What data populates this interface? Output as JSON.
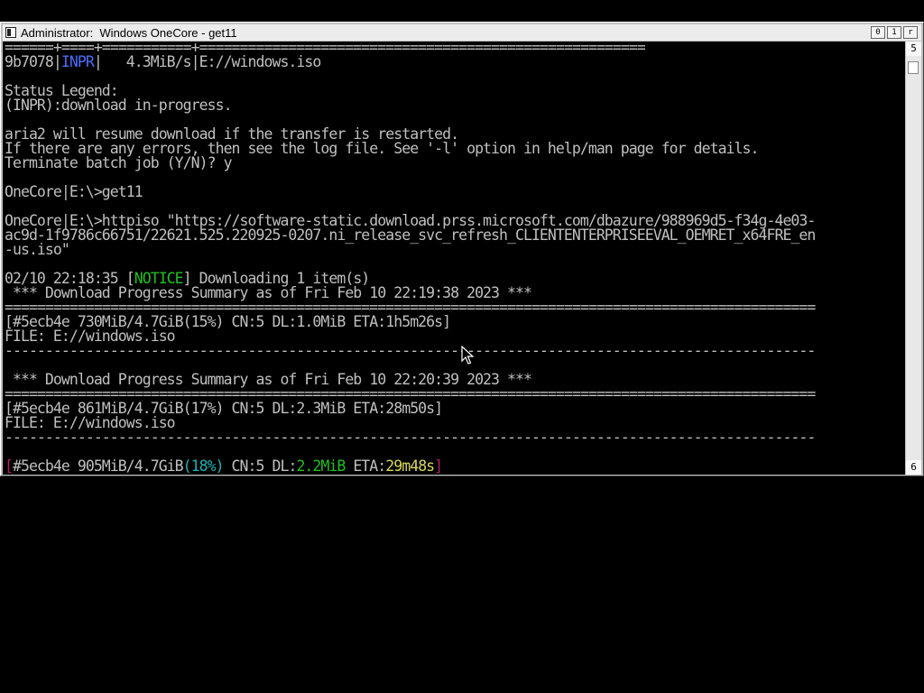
{
  "window": {
    "title": "Administrator:  Windows OneCore - get11",
    "buttons": [
      "0",
      "1",
      "r"
    ]
  },
  "scrollbar": {
    "top_label": "5",
    "bottom_label": "6"
  },
  "console": {
    "lines": [
      {
        "segments": [
          {
            "text": "======+====+===========+=======================================================",
            "color": "default"
          }
        ]
      },
      {
        "segments": [
          {
            "text": "9b7078|",
            "color": "default"
          },
          {
            "text": "INPR",
            "color": "blue"
          },
          {
            "text": "|   4.3MiB/s|E://windows.iso",
            "color": "default"
          }
        ]
      },
      {
        "segments": []
      },
      {
        "segments": [
          {
            "text": "Status Legend:",
            "color": "default"
          }
        ]
      },
      {
        "segments": [
          {
            "text": "(INPR):download in-progress.",
            "color": "default"
          }
        ]
      },
      {
        "segments": []
      },
      {
        "segments": [
          {
            "text": "aria2 will resume download if the transfer is restarted.",
            "color": "default"
          }
        ]
      },
      {
        "segments": [
          {
            "text": "If there are any errors, then see the log file. See '-l' option in help/man page for details.",
            "color": "default"
          }
        ]
      },
      {
        "segments": [
          {
            "text": "Terminate batch job (Y/N)? y",
            "color": "default"
          }
        ]
      },
      {
        "segments": []
      },
      {
        "segments": [
          {
            "text": "OneCore|E:\\>get11",
            "color": "default"
          }
        ]
      },
      {
        "segments": []
      },
      {
        "segments": [
          {
            "text": "OneCore|E:\\>httpiso \"https://software-static.download.prss.microsoft.com/dbazure/988969d5-f34g-4e03-",
            "color": "default"
          }
        ]
      },
      {
        "segments": [
          {
            "text": "ac9d-1f9786c66751/22621.525.220925-0207.ni_release_svc_refresh_CLIENTENTERPRISEEVAL_OEMRET_x64FRE_en",
            "color": "default"
          }
        ]
      },
      {
        "segments": [
          {
            "text": "-us.iso\"",
            "color": "default"
          }
        ]
      },
      {
        "segments": []
      },
      {
        "segments": [
          {
            "text": "02/10 22:18:35 [",
            "color": "default"
          },
          {
            "text": "NOTICE",
            "color": "green"
          },
          {
            "text": "] Downloading 1 item(s)",
            "color": "default"
          }
        ]
      },
      {
        "segments": [
          {
            "text": " *** Download Progress Summary as of Fri Feb 10 22:19:38 2023 ***",
            "color": "default"
          }
        ]
      },
      {
        "segments": [
          {
            "text": "====================================================================================================",
            "color": "default"
          }
        ]
      },
      {
        "segments": [
          {
            "text": "[#5ecb4e 730MiB/4.7GiB(15%) CN:5 DL:1.0MiB ETA:1h5m26s]",
            "color": "default"
          }
        ]
      },
      {
        "segments": [
          {
            "text": "FILE: E://windows.iso",
            "color": "default"
          }
        ]
      },
      {
        "segments": [
          {
            "text": "----------------------------------------------------------------------------------------------------",
            "color": "default"
          }
        ]
      },
      {
        "segments": []
      },
      {
        "segments": [
          {
            "text": " *** Download Progress Summary as of Fri Feb 10 22:20:39 2023 ***",
            "color": "default"
          }
        ]
      },
      {
        "segments": [
          {
            "text": "====================================================================================================",
            "color": "default"
          }
        ]
      },
      {
        "segments": [
          {
            "text": "[#5ecb4e 861MiB/4.7GiB(17%) CN:5 DL:2.3MiB ETA:28m50s]",
            "color": "default"
          }
        ]
      },
      {
        "segments": [
          {
            "text": "FILE: E://windows.iso",
            "color": "default"
          }
        ]
      },
      {
        "segments": [
          {
            "text": "----------------------------------------------------------------------------------------------------",
            "color": "default"
          }
        ]
      },
      {
        "segments": []
      },
      {
        "segments": [
          {
            "text": "[",
            "color": "magenta"
          },
          {
            "text": "#5ecb4e 905MiB/4.7GiB",
            "color": "default"
          },
          {
            "text": "(18%)",
            "color": "cyan"
          },
          {
            "text": " CN:5 DL:",
            "color": "default"
          },
          {
            "text": "2.2MiB",
            "color": "green"
          },
          {
            "text": " ETA:",
            "color": "default"
          },
          {
            "text": "29m48s",
            "color": "olive"
          },
          {
            "text": "]",
            "color": "magenta"
          }
        ]
      }
    ]
  },
  "colors": {
    "default": "#c0c0c0",
    "blue": "#4c6cff",
    "green": "#20c020",
    "cyan": "#20b0b0",
    "olive": "#d8d85a",
    "magenta": "#b02060",
    "background": "#000000"
  },
  "icons": {
    "window_icon": "console-window-icon",
    "pointer": "mouse-pointer-icon"
  }
}
